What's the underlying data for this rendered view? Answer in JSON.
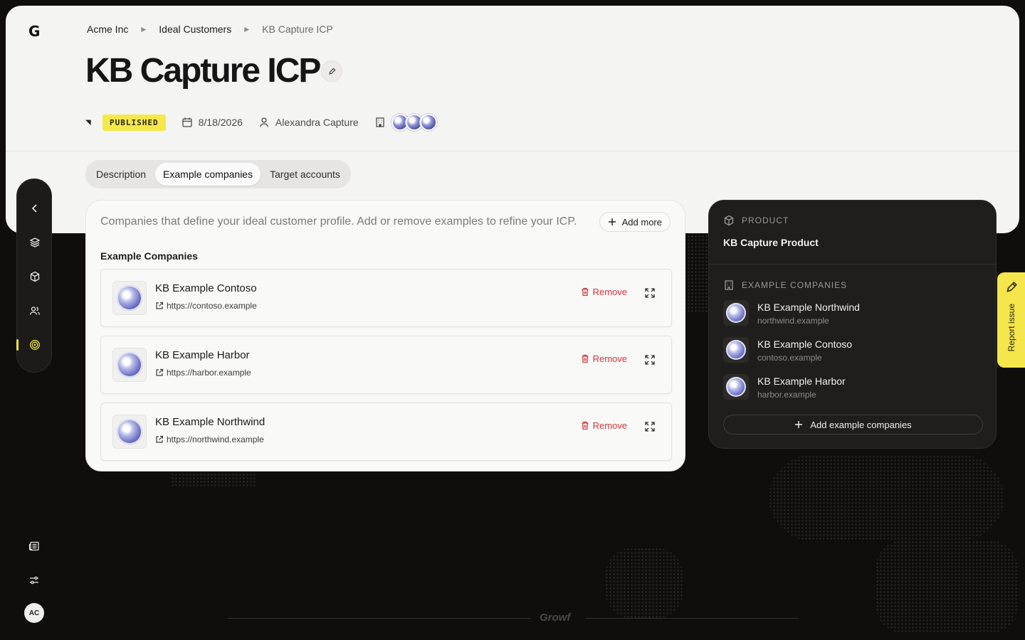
{
  "app": {
    "logo": "G"
  },
  "breadcrumb": {
    "items": [
      "Acme Inc",
      "Ideal Customers",
      "KB Capture ICP"
    ]
  },
  "page": {
    "title": "KB Capture ICP",
    "status": "PUBLISHED",
    "date": "8/18/2026",
    "owner": "Alexandra Capture"
  },
  "tabs": [
    {
      "label": "Description",
      "active": false
    },
    {
      "label": "Example companies",
      "active": true
    },
    {
      "label": "Target accounts",
      "active": false
    }
  ],
  "main": {
    "intro": "Companies that define your ideal customer profile. Add or remove examples to refine your ICP.",
    "add_more": "Add more",
    "section_label": "Example Companies",
    "remove_label": "Remove",
    "companies": [
      {
        "name": "KB Example Contoso",
        "url": "https://contoso.example"
      },
      {
        "name": "KB Example Harbor",
        "url": "https://harbor.example"
      },
      {
        "name": "KB Example Northwind",
        "url": "https://northwind.example"
      }
    ]
  },
  "side": {
    "product_label": "PRODUCT",
    "product_name": "KB Capture Product",
    "examples_label": "EXAMPLE COMPANIES",
    "examples": [
      {
        "name": "KB Example Northwind",
        "domain": "northwind.example"
      },
      {
        "name": "KB Example Contoso",
        "domain": "contoso.example"
      },
      {
        "name": "KB Example Harbor",
        "domain": "harbor.example"
      }
    ],
    "add_button": "Add example companies"
  },
  "report_issue": "Report issue",
  "user": {
    "initials": "AC"
  },
  "footer": {
    "brand": "Growf"
  },
  "colors": {
    "accent": "#f4e64b",
    "danger": "#d1363c",
    "dark_bg": "#0f0e0d"
  }
}
